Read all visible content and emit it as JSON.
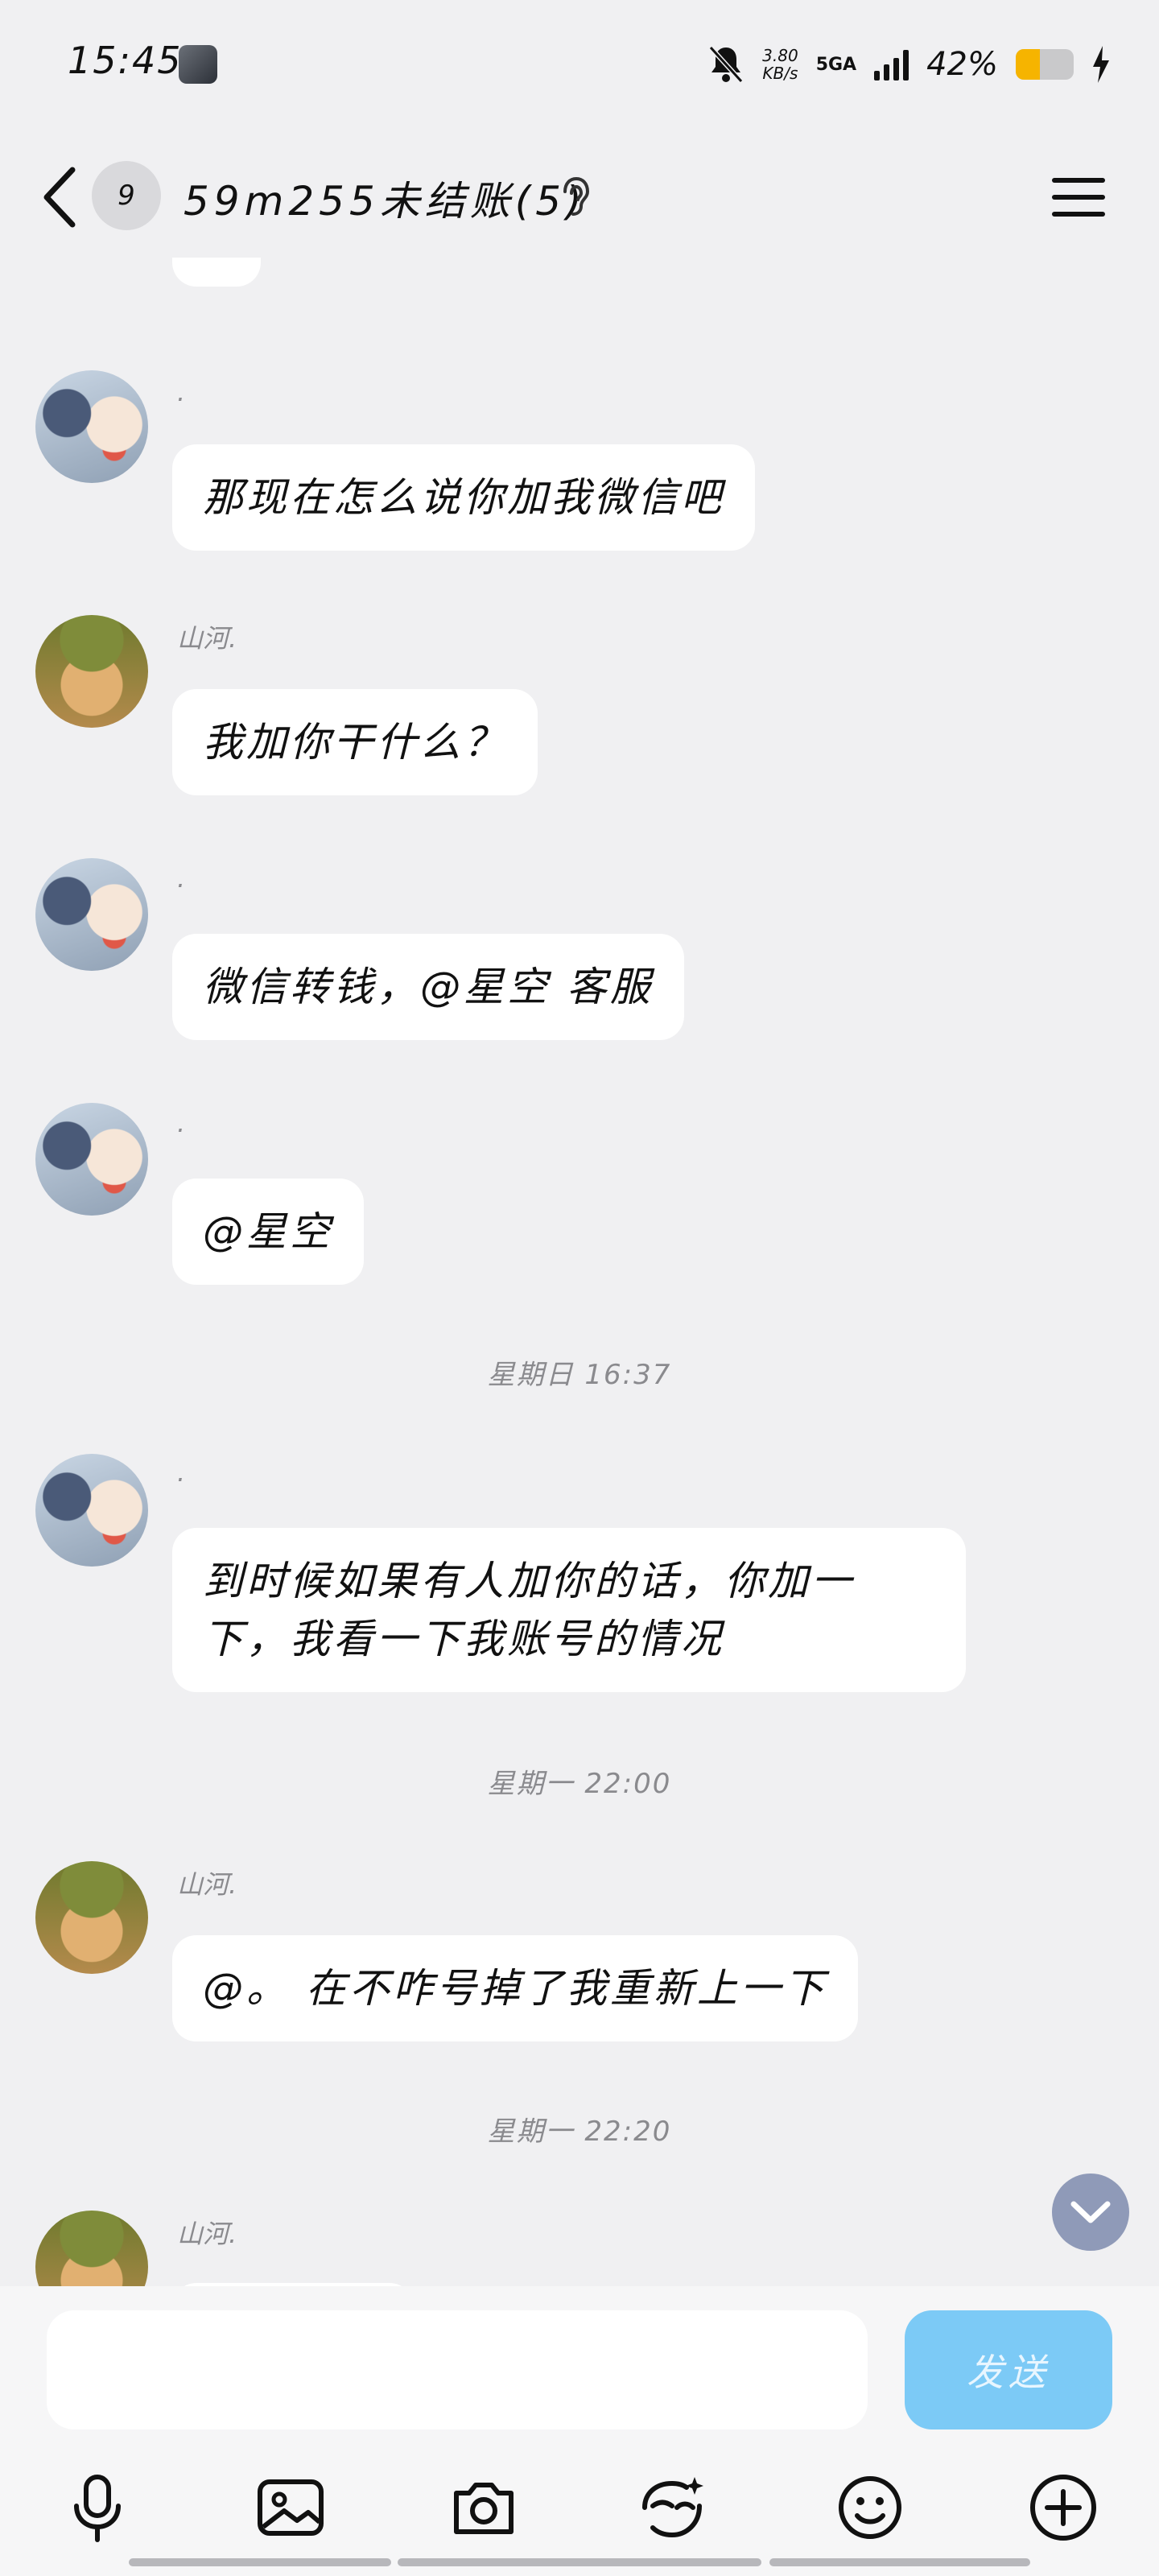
{
  "status_bar": {
    "time": "15:45",
    "net_speed_value": "3.80",
    "net_speed_unit": "KB/s",
    "network": "5GA",
    "battery_percent": "42%",
    "battery_level": 0.42
  },
  "header": {
    "unread_count": "9",
    "title": "59m255未结账(5)"
  },
  "messages": [
    {
      "sender": ".",
      "text": "那现在怎么说你加我微信吧"
    },
    {
      "sender": "山河.",
      "text": "我加你干什么？"
    },
    {
      "sender": ".",
      "text": "微信转钱，@星空 客服"
    },
    {
      "sender": ".",
      "text": "@星空"
    },
    {
      "sender": ".",
      "text": "到时候如果有人加你的话，你加一下，我看一下我账号的情况"
    },
    {
      "sender": "山河.",
      "text": "@。 在不咋号掉了我重新上一下"
    },
    {
      "sender": "山河.",
      "text": ""
    }
  ],
  "timestamps": [
    "星期日 16:37",
    "星期一 22:00",
    "星期一 22:20"
  ],
  "input": {
    "placeholder": "",
    "send_label": "发送"
  },
  "toolbar_icons": [
    "microphone-icon",
    "image-icon",
    "camera-icon",
    "magic-face-icon",
    "emoji-icon",
    "plus-icon"
  ],
  "colors": {
    "background": "#f0f0f2",
    "bubble": "#ffffff",
    "send_button": "#7ccaf6",
    "battery_fill": "#f6b400",
    "scroll_button": "#8f9ab8"
  }
}
